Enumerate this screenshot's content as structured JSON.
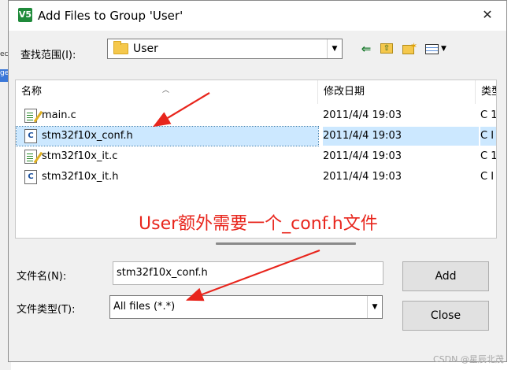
{
  "background": {
    "strips": [
      {
        "text": "ec",
        "selected": false
      },
      {
        "text": "ge",
        "selected": true
      }
    ]
  },
  "dialog": {
    "app_icon": "V5",
    "title": "Add Files to Group 'User'",
    "close_glyph": "✕",
    "look_in_label": "查找范围(I):",
    "look_in_value": "User",
    "toolbar": {
      "back_icon": "back-arrow-icon",
      "up_icon": "up-folder-icon",
      "new_folder_icon": "new-folder-icon",
      "view_menu_icon": "view-menu-icon"
    },
    "columns": {
      "name": "名称",
      "modified": "修改日期",
      "type": "类型"
    },
    "files": [
      {
        "name": "main.c",
        "modified": "2011/4/4 19:03",
        "type": "C 1",
        "icon": "c-source-icon",
        "selected": false
      },
      {
        "name": "stm32f10x_conf.h",
        "modified": "2011/4/4 19:03",
        "type": "C I",
        "icon": "c-header-icon",
        "selected": true
      },
      {
        "name": "stm32f10x_it.c",
        "modified": "2011/4/4 19:03",
        "type": "C 1",
        "icon": "c-source-icon",
        "selected": false
      },
      {
        "name": "stm32f10x_it.h",
        "modified": "2011/4/4 19:03",
        "type": "C I",
        "icon": "c-header-icon",
        "selected": false
      }
    ],
    "file_name_label": "文件名(N):",
    "file_name_value": "stm32f10x_conf.h",
    "file_type_label": "文件类型(T):",
    "file_type_value": "All files (*.*)",
    "add_button": "Add",
    "close_button": "Close"
  },
  "annotation": {
    "text": "User额外需要一个_conf.h文件",
    "color": "#e8251c"
  },
  "watermark": "CSDN @星辰北茂",
  "colors": {
    "selection": "#cce8ff",
    "dialog_bg": "#f0f0f0",
    "app_icon": "#1f8a3a"
  }
}
